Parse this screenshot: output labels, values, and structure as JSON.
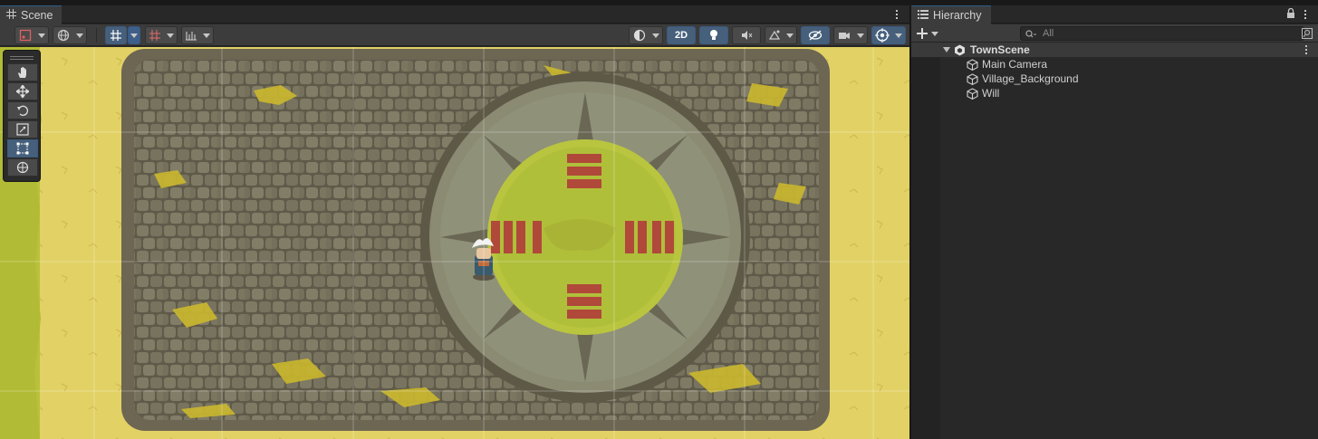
{
  "scene_tab": {
    "title": "Scene"
  },
  "scene_toolbar": {
    "mode_2d_label": "2D"
  },
  "hierarchy_tab": {
    "title": "Hierarchy"
  },
  "hierarchy_search": {
    "placeholder": "All"
  },
  "hierarchy": {
    "scene_name": "TownScene",
    "objects": [
      "Main Camera",
      "Village_Background",
      "Will"
    ]
  },
  "colors": {
    "sand": "#e0cf63",
    "cobble": "#7d7a64",
    "cobble_dark": "#5a5546",
    "moss": "#c6b52b",
    "plaza_grass": "#b6c33f",
    "brick": "#b0493a",
    "accent_blue": "#46607c"
  }
}
